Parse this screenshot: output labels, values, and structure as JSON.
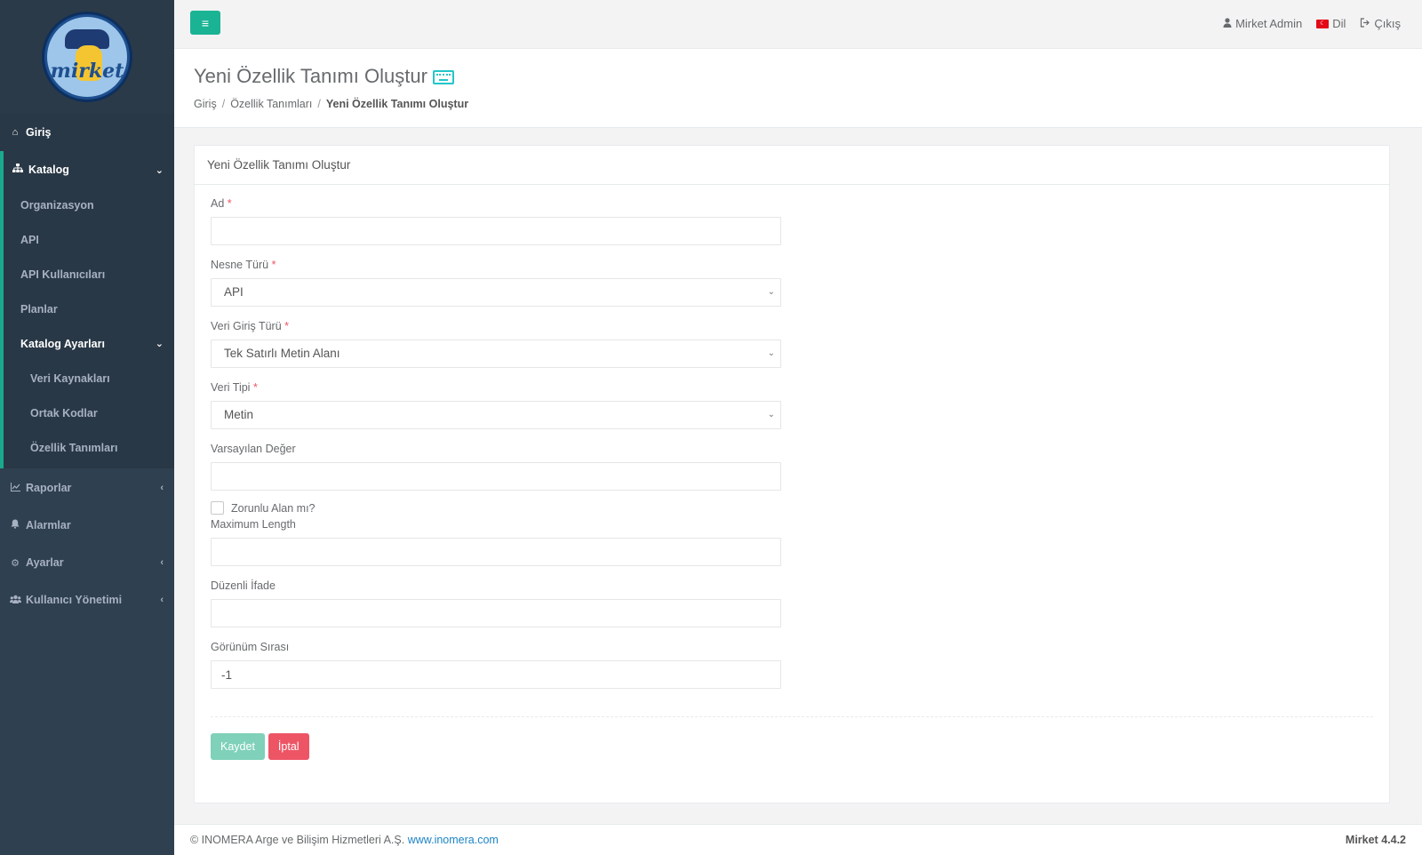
{
  "brand": {
    "logo_text": "mirket"
  },
  "sidebar": {
    "home": {
      "label": "Giriş",
      "icon": "home-icon"
    },
    "catalog": {
      "label": "Katalog",
      "icon": "sitemap-icon",
      "items": [
        {
          "label": "Organizasyon"
        },
        {
          "label": "API"
        },
        {
          "label": "API Kullanıcıları"
        },
        {
          "label": "Planlar"
        }
      ],
      "settings": {
        "label": "Katalog Ayarları",
        "items": [
          {
            "label": "Veri Kaynakları"
          },
          {
            "label": "Ortak Kodlar"
          },
          {
            "label": "Özellik Tanımları"
          }
        ]
      }
    },
    "reports": {
      "label": "Raporlar",
      "icon": "chart-icon"
    },
    "alarms": {
      "label": "Alarmlar",
      "icon": "bell-icon"
    },
    "settings": {
      "label": "Ayarlar",
      "icon": "gears-icon"
    },
    "users": {
      "label": "Kullanıcı Yönetimi",
      "icon": "users-icon"
    }
  },
  "topbar": {
    "user": "Mirket Admin",
    "language": "Dil",
    "logout": "Çıkış"
  },
  "page": {
    "title": "Yeni Özellik Tanımı Oluştur",
    "breadcrumb": [
      "Giriş",
      "Özellik Tanımları",
      "Yeni Özellik Tanımı Oluştur"
    ]
  },
  "form": {
    "panel_title": "Yeni Özellik Tanımı Oluştur",
    "name": {
      "label": "Ad",
      "value": ""
    },
    "object_type": {
      "label": "Nesne Türü",
      "value": "API"
    },
    "input_type": {
      "label": "Veri Giriş Türü",
      "value": "Tek Satırlı Metin Alanı"
    },
    "data_type": {
      "label": "Veri Tipi",
      "value": "Metin"
    },
    "default_value": {
      "label": "Varsayılan Değer",
      "value": ""
    },
    "required": {
      "label": "Zorunlu Alan mı?",
      "checked": false
    },
    "max_length": {
      "label": "Maximum Length",
      "value": ""
    },
    "regex": {
      "label": "Düzenli İfade",
      "value": ""
    },
    "display_order": {
      "label": "Görünüm Sırası",
      "value": "-1"
    },
    "save_label": "Kaydet",
    "cancel_label": "İptal",
    "required_marker": "*"
  },
  "footer": {
    "copyright": "© INOMERA Arge ve Bilişim Hizmetleri A.Ş.",
    "link": "www.inomera.com",
    "version": "Mirket 4.4.2"
  },
  "colors": {
    "sidebar": "#2f4050",
    "accent": "#1ab394",
    "danger": "#ed5565",
    "link": "#1c84c6"
  }
}
